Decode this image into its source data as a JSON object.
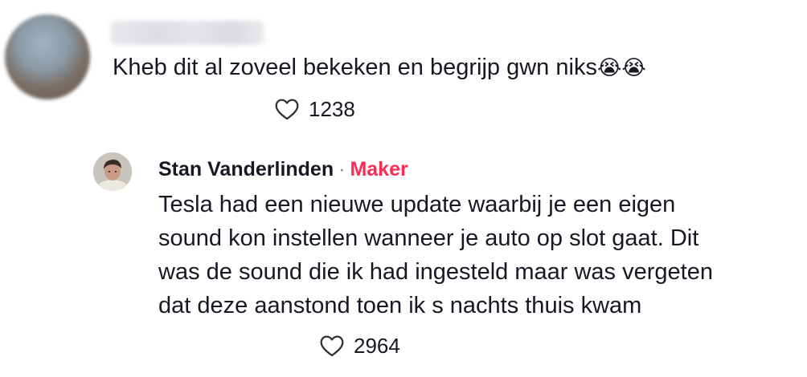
{
  "comment": {
    "author_name": "",
    "text": "Kheb dit al zoveel bekeken en begrijp gwn niks",
    "emojis": "😭😭",
    "likes": "1238",
    "like_icon": "heart-outline-icon"
  },
  "reply": {
    "author_name": "Stan Vanderlinden",
    "separator": "·",
    "badge": "Maker",
    "badge_color": "#fe2c55",
    "text_lines": [
      "Tesla had een nieuwe update waarbij je een eigen",
      "sound kon instellen wanneer je auto op slot gaat. Dit",
      "was de sound die ik had ingesteld maar was vergeten",
      "dat deze aanstond toen ik s nachts thuis kwam"
    ],
    "likes": "2964",
    "like_icon": "heart-outline-icon"
  }
}
